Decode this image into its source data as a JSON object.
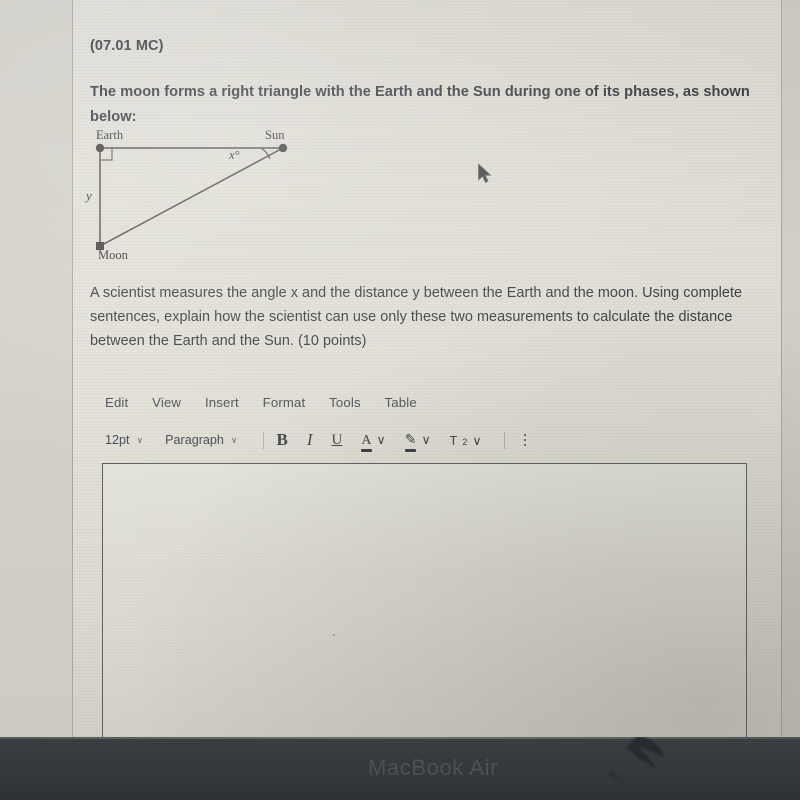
{
  "question": {
    "code": "(07.01 MC)",
    "stem": "The moon forms a right triangle with the Earth and the Sun during one of its phases, as shown below:",
    "body": "A scientist measures the angle x and the distance y between the Earth and the moon. Using complete sentences, explain how the scientist can use only these two measurements to calculate the distance between the Earth and the Sun. (10 points)"
  },
  "diagram": {
    "type": "right-triangle",
    "vertices": {
      "earth": "Earth",
      "sun": "Sun",
      "moon": "Moon"
    },
    "side_label_vertical": "y",
    "angle_label": "x°",
    "right_angle_at": "Earth",
    "angle_marked_at": "Sun"
  },
  "editor": {
    "menu": [
      {
        "label": "Edit"
      },
      {
        "label": "View"
      },
      {
        "label": "Insert"
      },
      {
        "label": "Format"
      },
      {
        "label": "Tools"
      },
      {
        "label": "Table"
      }
    ],
    "toolbar": {
      "font_size": "12pt",
      "block_format": "Paragraph",
      "bold": "B",
      "italic": "I",
      "underline": "U",
      "text_color": "A",
      "highlight": "✎",
      "superscript": "T",
      "superscript_exponent": "2",
      "caret": "∨",
      "more_options": "⋮"
    },
    "content": ""
  },
  "device": {
    "brand": "MacBook Air"
  },
  "colors": {
    "screen_paper": "#ded",
    "text": "#3c4147",
    "bezel": "#33383b",
    "border": "#5c6368"
  }
}
